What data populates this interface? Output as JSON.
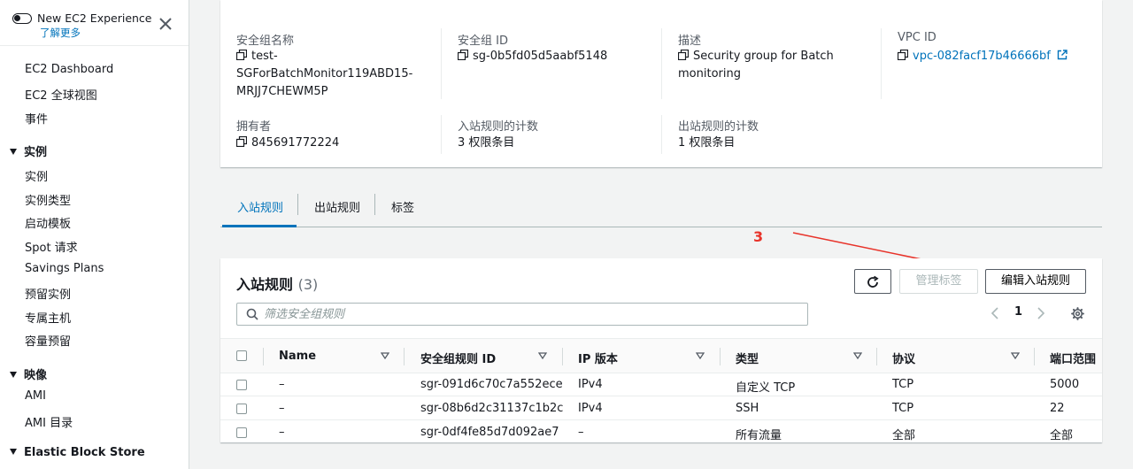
{
  "sidebar": {
    "experience_title": "New EC2 Experience",
    "experience_link": "了解更多",
    "items": [
      "EC2 Dashboard",
      "EC2 全球视图",
      "事件"
    ],
    "sections": [
      {
        "title": "实例",
        "items": [
          "实例",
          "实例类型",
          "启动模板",
          "Spot 请求",
          "Savings Plans",
          "预留实例",
          "专属主机",
          "容量预留"
        ]
      },
      {
        "title": "映像",
        "items": [
          "AMI",
          "AMI 目录"
        ]
      },
      {
        "title": "Elastic Block Store",
        "items": []
      }
    ]
  },
  "details": {
    "name_label": "安全组名称",
    "name_value_lines": [
      "test-",
      "SGForBatchMonitor119ABD15-",
      "MRJJ7CHEWM5P"
    ],
    "id_label": "安全组 ID",
    "id_value": "sg-0b5fd05d5aabf5148",
    "desc_label": "描述",
    "desc_value_lines": [
      "Security group for Batch",
      "monitoring"
    ],
    "vpc_label": "VPC ID",
    "vpc_value": "vpc-082facf17b46666bf",
    "owner_label": "拥有者",
    "owner_value": "845691772224",
    "inbound_count_label": "入站规则的计数",
    "inbound_count_value": "3 权限条目",
    "outbound_count_label": "出站规则的计数",
    "outbound_count_value": "1 权限条目"
  },
  "tabs": [
    "入站规则",
    "出站规则",
    "标签"
  ],
  "annotation": {
    "label": "3",
    "color": "#e8332a"
  },
  "rules": {
    "title": "入站规则",
    "count": "(3)",
    "manage_tags_button": "管理标签",
    "edit_button": "编辑入站规则",
    "search_placeholder": "筛选安全组规则",
    "page": "1",
    "columns": [
      "Name",
      "安全组规则 ID",
      "IP 版本",
      "类型",
      "协议",
      "端口范围"
    ],
    "rows": [
      [
        "–",
        "sgr-091d6c70c7a552ece",
        "IPv4",
        "自定义 TCP",
        "TCP",
        "5000"
      ],
      [
        "–",
        "sgr-08b6d2c31137c1b2c",
        "IPv4",
        "SSH",
        "TCP",
        "22"
      ],
      [
        "–",
        "sgr-0df4fe85d7d092ae7",
        "–",
        "所有流量",
        "全部",
        "全部"
      ]
    ]
  },
  "colors": {
    "link": "#0073bb",
    "annotation": "#e8332a"
  }
}
